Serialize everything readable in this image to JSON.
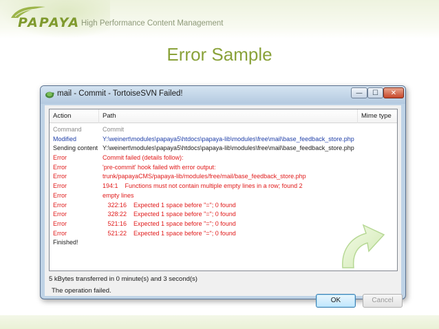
{
  "slide": {
    "logo_text": "PAPAYA",
    "tagline": "High Performance Content Management",
    "title": "Error Sample"
  },
  "window": {
    "title": "mail - Commit - TortoiseSVN Failed!",
    "controls": {
      "minimize": "—",
      "maximize": "☐",
      "close": "✕"
    }
  },
  "log": {
    "columns": {
      "action": "Action",
      "path": "Path",
      "mime": "Mime type"
    },
    "rows": [
      {
        "action": "Command",
        "path": "Commit",
        "style": "gray"
      },
      {
        "action": "Modified",
        "path": "Y:\\weinert\\modules\\papaya5\\htdocs\\papaya-lib\\modules\\free\\mail\\base_feedback_store.php",
        "style": "blue"
      },
      {
        "action": "Sending content",
        "path": "Y:\\weinert\\modules\\papaya5\\htdocs\\papaya-lib\\modules\\free\\mail\\base_feedback_store.php",
        "style": "black"
      },
      {
        "action": "Error",
        "path": "Commit failed (details follow):",
        "style": "red"
      },
      {
        "action": "Error",
        "path": "'pre-commit' hook failed with error output:",
        "style": "red"
      },
      {
        "action": "Error",
        "path": "trunk/papayaCMS/papaya-lib/modules/free/mail/base_feedback_store.php",
        "style": "red"
      },
      {
        "action": "Error",
        "path": "194:1    Functions must not contain multiple empty lines in a row; found 2",
        "style": "red"
      },
      {
        "action": "Error",
        "path": "empty lines",
        "style": "red"
      },
      {
        "action": "Error",
        "path": "   322:16    Expected 1 space before \"=\"; 0 found",
        "style": "red"
      },
      {
        "action": "Error",
        "path": "   328:22    Expected 1 space before \"=\"; 0 found",
        "style": "red"
      },
      {
        "action": "Error",
        "path": "   521:16    Expected 1 space before \"=\"; 0 found",
        "style": "red"
      },
      {
        "action": "Error",
        "path": "   521:22    Expected 1 space before \"=\"; 0 found",
        "style": "red"
      },
      {
        "action": "Finished!",
        "path": "",
        "style": "black"
      }
    ]
  },
  "status": "5 kBytes transferred in 0 minute(s) and 3 second(s)",
  "message": "The operation failed.",
  "buttons": {
    "ok": "OK",
    "cancel": "Cancel"
  },
  "icons": {
    "title_icon": "tortoisesvn-icon",
    "logo_icon": "papaya-leaf-icon",
    "overlay_icon": "curved-arrow-icon"
  },
  "colors": {
    "brand_green": "#8aa23a",
    "error_red": "#e01a1a",
    "modified_blue": "#1f3fa8"
  }
}
